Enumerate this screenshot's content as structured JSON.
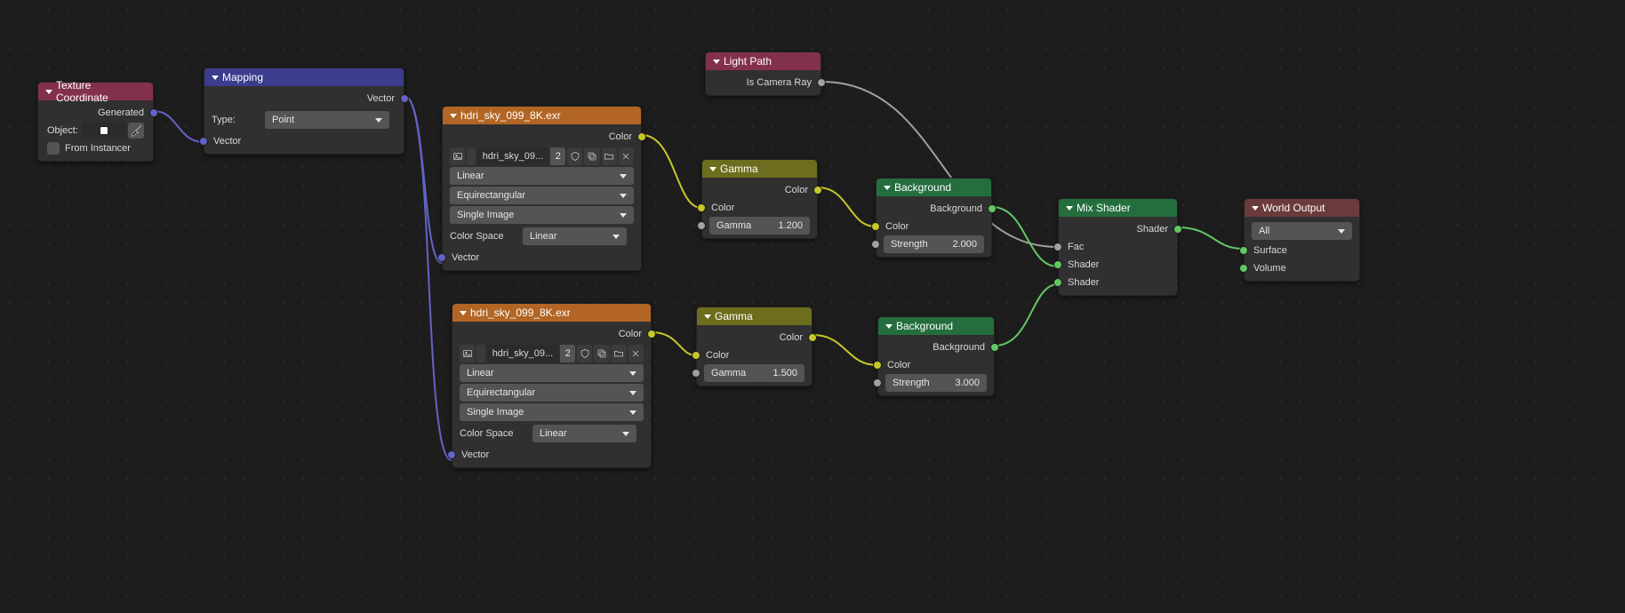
{
  "texCoord": {
    "title": "Texture Coordinate",
    "out_generated": "Generated",
    "object_label": "Object:",
    "object_value": "",
    "from_instancer": "From Instancer"
  },
  "mapping": {
    "title": "Mapping",
    "out_vector": "Vector",
    "type_label": "Type:",
    "type_value": "Point",
    "in_vector": "Vector"
  },
  "envTexA": {
    "title": "hdri_sky_099_8K.exr",
    "out_color": "Color",
    "image_name": "hdri_sky_09...",
    "users": "2",
    "interp": "Linear",
    "proj": "Equirectangular",
    "frames": "Single Image",
    "colorspace_label": "Color Space",
    "colorspace_value": "Linear",
    "in_vector": "Vector"
  },
  "gammaA": {
    "title": "Gamma",
    "out_color": "Color",
    "in_color": "Color",
    "gamma_label": "Gamma",
    "gamma_value": "1.200"
  },
  "lightPath": {
    "title": "Light Path",
    "out_camera": "Is Camera Ray"
  },
  "bgA": {
    "title": "Background",
    "out_background": "Background",
    "in_color": "Color",
    "strength_label": "Strength",
    "strength_value": "2.000"
  },
  "envTexB": {
    "title": "hdri_sky_099_8K.exr",
    "out_color": "Color",
    "image_name": "hdri_sky_09...",
    "users": "2",
    "interp": "Linear",
    "proj": "Equirectangular",
    "frames": "Single Image",
    "colorspace_label": "Color Space",
    "colorspace_value": "Linear",
    "in_vector": "Vector"
  },
  "gammaB": {
    "title": "Gamma",
    "out_color": "Color",
    "in_color": "Color",
    "gamma_label": "Gamma",
    "gamma_value": "1.500"
  },
  "bgB": {
    "title": "Background",
    "out_background": "Background",
    "in_color": "Color",
    "strength_label": "Strength",
    "strength_value": "3.000"
  },
  "mix": {
    "title": "Mix Shader",
    "out_shader": "Shader",
    "in_fac": "Fac",
    "in_shader1": "Shader",
    "in_shader2": "Shader"
  },
  "worldOut": {
    "title": "World Output",
    "target": "All",
    "in_surface": "Surface",
    "in_volume": "Volume"
  }
}
